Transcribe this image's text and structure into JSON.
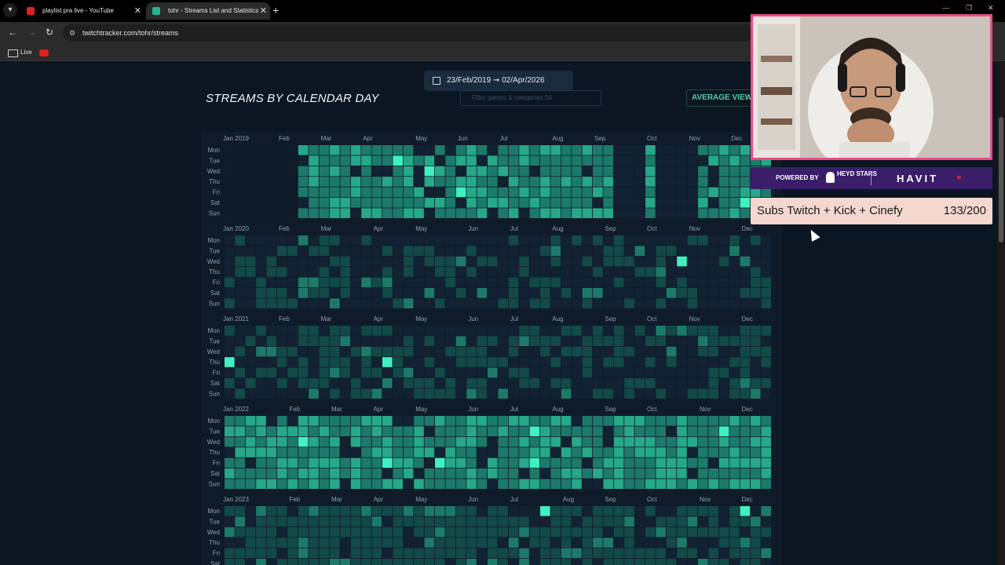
{
  "browser": {
    "tabs": [
      {
        "title": "playlist pra live - YouTube",
        "favicon": "youtube-icon",
        "active": false,
        "favicon_color": "#e02020"
      },
      {
        "title": "tohr - Streams List and Statistics",
        "favicon": "twitchtracker-icon",
        "active": true,
        "favicon_color": "#1fb891"
      }
    ],
    "url": "twitchtracker.com/tohr/streams",
    "bookmarks": [
      {
        "label": "Live",
        "icon": "folder-icon"
      }
    ]
  },
  "page": {
    "date_range": {
      "start": "23/Feb/2019",
      "end": "02/Apr/2026",
      "arrow": "➞"
    },
    "section_title": "STREAMS BY CALENDAR DAY",
    "filter_placeholder": "Filter games & categories",
    "filter_count": "04",
    "average_button": "AVERAGE VIEWERS"
  },
  "overlay": {
    "sponsor": {
      "powered_by": "POWERED BY",
      "brand_1": "HEYD STARS",
      "brand_2": "HAVIT"
    },
    "subgoal": {
      "label": "Subs Twitch + Kick + Cinefy",
      "count": "133/200"
    }
  },
  "chart_data": {
    "type": "heatmap",
    "title": "STREAMS BY CALENDAR DAY",
    "weekdays": [
      "Mon",
      "Tue",
      "Wed",
      "Thu",
      "Fri",
      "Sat",
      "Sun"
    ],
    "years": [
      {
        "label": "Jan 2019",
        "months": [
          "Feb",
          "Mar",
          "Apr",
          "May",
          "Jun",
          "Jul",
          "Aug",
          "Sep",
          "Oct",
          "Nov",
          "Dec"
        ],
        "month_weeks": [
          5,
          9,
          13,
          18,
          22,
          26,
          31,
          35,
          40,
          44,
          48
        ],
        "active_from_week": 7,
        "density": 0.85,
        "gaps": [
          [
            41,
            44
          ],
          [
            37,
            39
          ]
        ]
      },
      {
        "label": "Jan 2020",
        "months": [
          "Feb",
          "Mar",
          "Apr",
          "May",
          "Jun",
          "Jul",
          "Aug",
          "Sep",
          "Oct",
          "Nov",
          "Dec"
        ],
        "month_weeks": [
          5,
          9,
          14,
          18,
          23,
          27,
          31,
          36,
          40,
          44,
          49
        ],
        "active_from_week": 0,
        "density": 0.35
      },
      {
        "label": "Jan 2021",
        "months": [
          "Feb",
          "Mar",
          "Apr",
          "May",
          "Jun",
          "Jul",
          "Aug",
          "Sep",
          "Oct",
          "Nov",
          "Dec"
        ],
        "month_weeks": [
          5,
          9,
          14,
          18,
          23,
          27,
          31,
          36,
          40,
          44,
          49
        ],
        "active_from_week": 0,
        "density": 0.45
      },
      {
        "label": "Jan 2022",
        "months": [
          "Feb",
          "Mar",
          "Apr",
          "May",
          "Jun",
          "Jul",
          "Aug",
          "Sep",
          "Oct",
          "Nov",
          "Dec"
        ],
        "month_weeks": [
          6,
          10,
          14,
          18,
          23,
          27,
          31,
          36,
          40,
          45,
          49
        ],
        "active_from_week": 0,
        "density": 0.9
      },
      {
        "label": "Jan 2023",
        "months": [
          "Feb",
          "Mar",
          "Apr",
          "May",
          "Jun",
          "Jul",
          "Aug",
          "Sep",
          "Oct",
          "Nov",
          "Dec"
        ],
        "month_weeks": [
          6,
          10,
          14,
          18,
          23,
          27,
          32,
          36,
          40,
          45,
          49
        ],
        "active_from_week": 0,
        "density": 0.75
      }
    ],
    "colors": {
      "empty": "#0f1b29",
      "low": "#134a48",
      "mid": "#1d7a6a",
      "high": "#26a889",
      "peak": "#3ff0c0"
    }
  }
}
